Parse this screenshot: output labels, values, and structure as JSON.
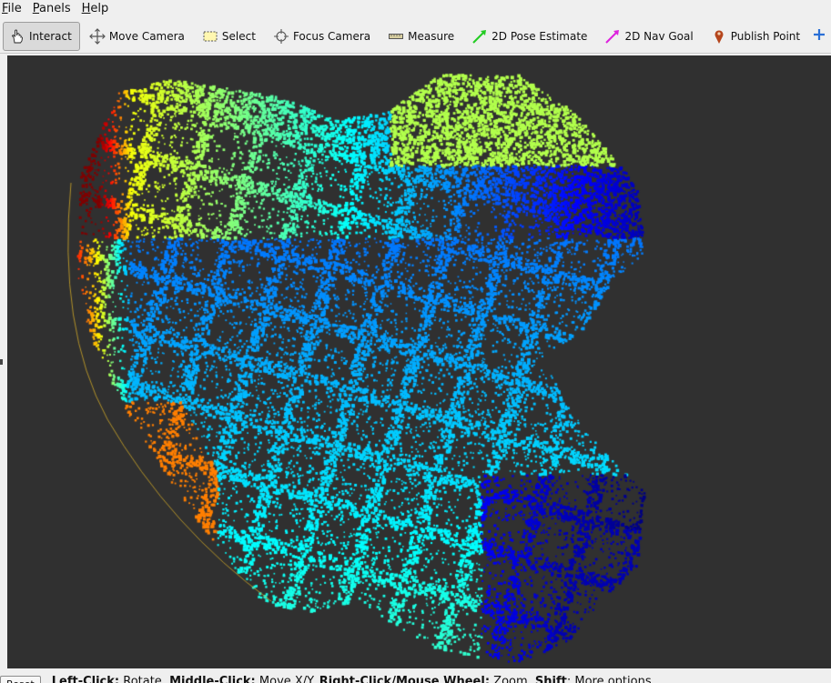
{
  "menu": {
    "file": {
      "m": "F",
      "rest": "ile"
    },
    "panels": {
      "m": "P",
      "rest": "anels"
    },
    "help": {
      "m": "H",
      "rest": "elp"
    }
  },
  "toolbar": {
    "interact": "Interact",
    "move_camera": "Move Camera",
    "select": "Select",
    "focus_camera": "Focus Camera",
    "measure": "Measure",
    "pose_estimate": "2D Pose Estimate",
    "nav_goal": "2D Nav Goal",
    "publish_point": "Publish Point"
  },
  "icons": {
    "interact": "hand-pointer-icon",
    "move_camera": "move-arrows-icon",
    "select": "selection-box-icon",
    "focus_camera": "crosshair-icon",
    "measure": "ruler-icon",
    "pose_estimate": "green-arrow-icon",
    "nav_goal": "magenta-arrow-icon",
    "publish_point": "map-pin-icon",
    "add": "plus-icon"
  },
  "colors": {
    "viewport_bg": "#303030",
    "pose_arrow": "#22cc22",
    "nav_arrow": "#dd22dd",
    "pin": "#b5451c"
  },
  "status": {
    "reset": "Reset",
    "left_click": "Left-Click:",
    "left_click_action": " Rotate. ",
    "middle_click": "Middle-Click:",
    "middle_click_action": " Move X/Y. ",
    "right_click": "Right-Click/Mouse Wheel:",
    "right_click_action": " Zoom. ",
    "shift": "Shift",
    "shift_action": ": More options."
  }
}
